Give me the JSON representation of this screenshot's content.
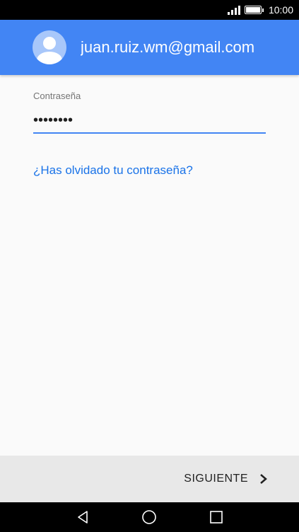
{
  "status_bar": {
    "time": "10:00",
    "icons": [
      "signal-icon",
      "battery-icon"
    ]
  },
  "header": {
    "account_email": "juan.ruiz.wm@gmail.com",
    "avatar_icon": "account-circle-icon",
    "background_color": "#4285f4"
  },
  "form": {
    "password_label": "Contraseña",
    "password_value": "••••••••",
    "forgot_link": "¿Has olvidado tu contraseña?",
    "accent_color": "#4285f4"
  },
  "footer": {
    "next_label": "SIGUIENTE",
    "next_icon": "chevron-right-icon"
  },
  "nav_bar": {
    "buttons": [
      "back-icon",
      "home-icon",
      "recents-icon"
    ]
  }
}
